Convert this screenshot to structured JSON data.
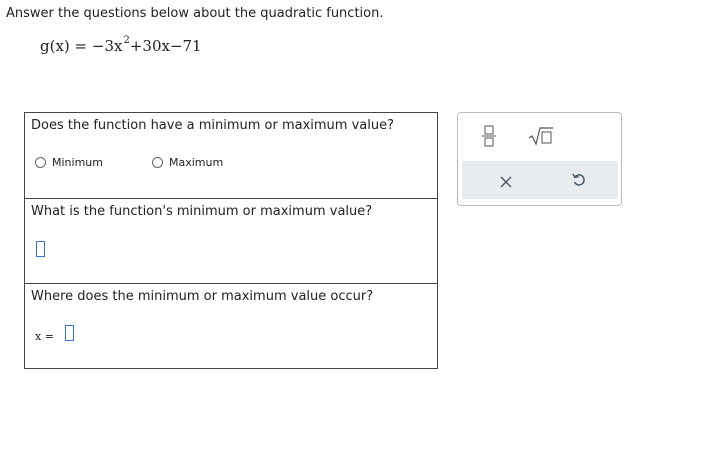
{
  "instruction": "Answer the questions below about the quadratic function.",
  "function": {
    "lhs": "g(x) = −3x",
    "exponent": "2",
    "rhs": "+30x−71"
  },
  "questions": {
    "q1": {
      "text": "Does the function have a minimum or maximum value?",
      "options": [
        "Minimum",
        "Maximum"
      ]
    },
    "q2": {
      "text": "What is the function's minimum or maximum value?",
      "answer_value": ""
    },
    "q3": {
      "text": "Where does the minimum or maximum value occur?",
      "prefix": "x =",
      "answer_value": ""
    }
  },
  "toolbox": {
    "tools": [
      "fraction-icon",
      "square-root-icon"
    ],
    "actions": [
      "clear-icon",
      "undo-icon"
    ]
  },
  "colors": {
    "input_border": "#3a6fd8",
    "toolbar_bg": "#e9ecef",
    "action_icon": "#4a5a6a"
  }
}
